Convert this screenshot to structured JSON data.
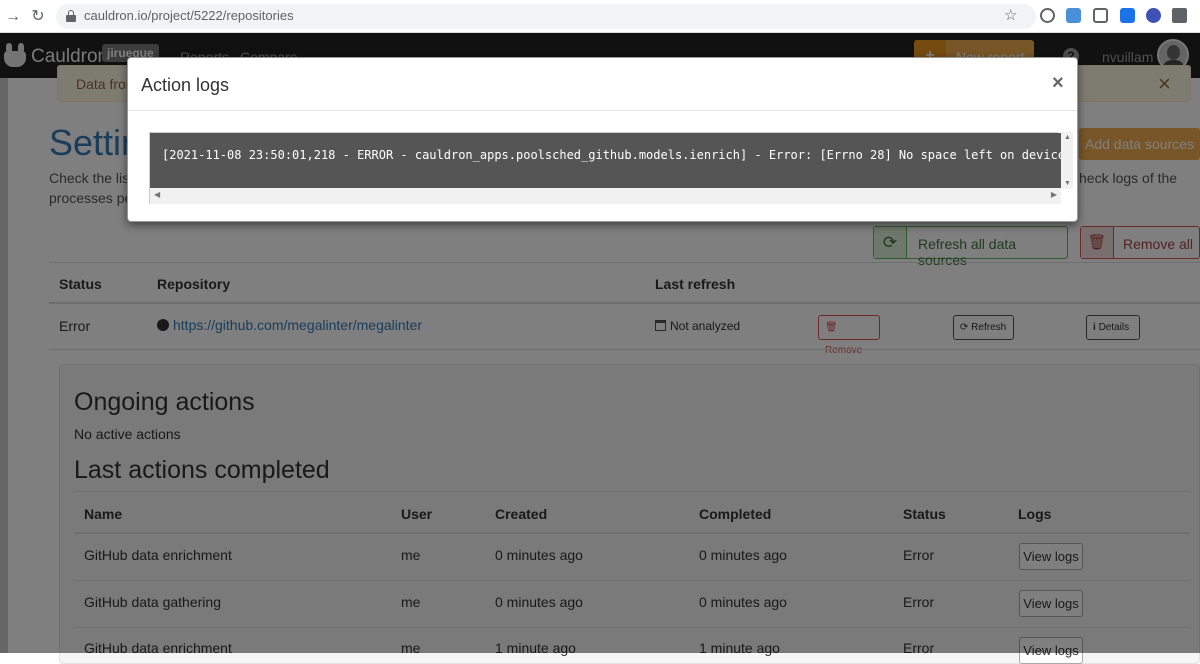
{
  "browser": {
    "url": "cauldron.io/project/5222/repositories"
  },
  "navbar": {
    "brand": "Cauldron",
    "badge": "jiruegue",
    "links": [
      "Reports",
      "Compare"
    ],
    "new_report_label": "New report",
    "user": "nvuillam"
  },
  "page": {
    "alert_text": "Data from",
    "title": "Settin",
    "desc_line1": "Check the list",
    "desc_line2": "processes pe",
    "desc_right": "heck logs of the",
    "add_sources_label": "Add data sources",
    "refresh_all_label": "Refresh all data sources",
    "remove_all_label": "Remove all"
  },
  "repositories": {
    "columns": [
      "Status",
      "Repository",
      "Last refresh"
    ],
    "rows": [
      {
        "status": "Error",
        "repository": "https://github.com/megalinter/megalinter",
        "last_refresh": "Not analyzed",
        "remove_label": "Remove",
        "refresh_label": "Refresh",
        "details_label": "Details"
      }
    ]
  },
  "actions": {
    "ongoing_title": "Ongoing actions",
    "no_active": "No active actions",
    "completed_title": "Last actions completed",
    "columns": [
      "Name",
      "User",
      "Created",
      "Completed",
      "Status",
      "Logs"
    ],
    "rows": [
      {
        "name": "GitHub data enrichment",
        "user": "me",
        "created": "0 minutes ago",
        "completed": "0 minutes ago",
        "status": "Error",
        "logs_label": "View logs"
      },
      {
        "name": "GitHub data gathering",
        "user": "me",
        "created": "0 minutes ago",
        "completed": "0 minutes ago",
        "status": "Error",
        "logs_label": "View logs"
      },
      {
        "name": "GitHub data enrichment",
        "user": "me",
        "created": "1 minute ago",
        "completed": "1 minute ago",
        "status": "Error",
        "logs_label": "View logs"
      }
    ]
  },
  "modal": {
    "title": "Action logs",
    "close_symbol": "×",
    "log_line": "[2021-11-08 23:50:01,218 - ERROR - cauldron_apps.poolsched_github.models.ienrich] - Error: [Errno 28] No space left on device"
  },
  "colors": {
    "navbar_bg": "#222222",
    "accent_blue": "#337ab7",
    "warning_orange": "#f0ad4e",
    "success_green": "#5cb85c",
    "danger_red": "#d9534f",
    "log_bg": "#555555"
  }
}
